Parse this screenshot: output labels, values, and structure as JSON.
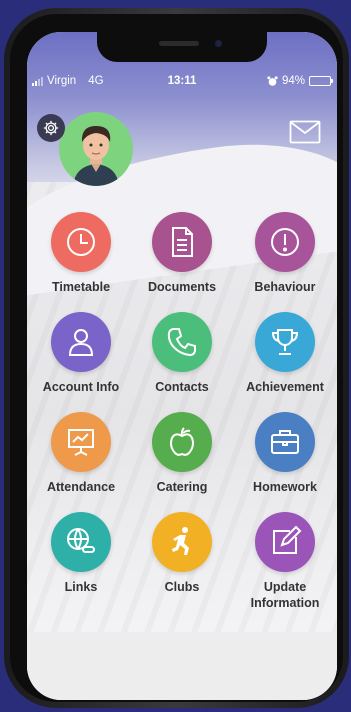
{
  "status_bar": {
    "carrier": "Virgin",
    "network": "4G",
    "time": "13:11",
    "battery": "94%",
    "battery_level": 0.94
  },
  "header": {
    "settings_icon": "gear-icon",
    "avatar": "student-avatar",
    "mail_icon": "envelope-icon"
  },
  "tiles": [
    {
      "label": "Timetable",
      "color": "#ee6b61",
      "icon": "clock-icon"
    },
    {
      "label": "Documents",
      "color": "#a8528f",
      "icon": "document-icon"
    },
    {
      "label": "Behaviour",
      "color": "#a7549a",
      "icon": "exclamation-icon"
    },
    {
      "label": "Account Info",
      "color": "#7a63c9",
      "icon": "user-icon"
    },
    {
      "label": "Contacts",
      "color": "#4cbe7c",
      "icon": "phone-icon"
    },
    {
      "label": "Achievement",
      "color": "#3aa8d6",
      "icon": "trophy-icon"
    },
    {
      "label": "Attendance",
      "color": "#ef9a4a",
      "icon": "presentation-icon"
    },
    {
      "label": "Catering",
      "color": "#56ad4d",
      "icon": "apple-icon"
    },
    {
      "label": "Homework",
      "color": "#4a7fc4",
      "icon": "briefcase-icon"
    },
    {
      "label": "Links",
      "color": "#2eb0a8",
      "icon": "globe-link-icon"
    },
    {
      "label": "Clubs",
      "color": "#f2b124",
      "icon": "running-icon"
    },
    {
      "label": "Update\nInformation",
      "color": "#9b54b8",
      "icon": "edit-icon"
    }
  ]
}
